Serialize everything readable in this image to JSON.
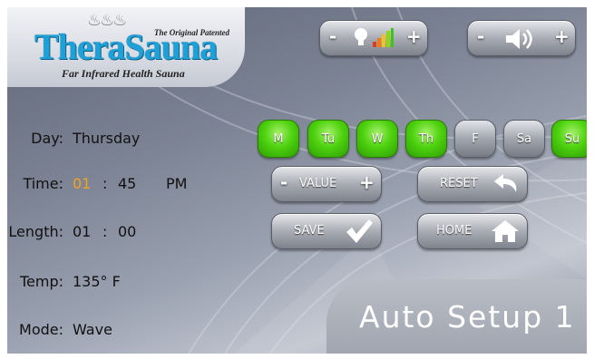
{
  "brand": {
    "name": "TheraSauna",
    "tagline": "The Original Patented",
    "subtitle": "Far Infrared Health Sauna"
  },
  "controls": {
    "light": {
      "minus": "-",
      "plus": "+",
      "icon": "bulb-level-icon"
    },
    "volume": {
      "minus": "-",
      "plus": "+",
      "icon": "speaker-icon"
    }
  },
  "info": {
    "day_label": "Day:",
    "day_value": "Thursday",
    "time_label": "Time:",
    "time_hour": "01",
    "time_sep": ":",
    "time_min": "45",
    "time_ampm": "PM",
    "length_label": "Length:",
    "length_hour": "01",
    "length_sep": ":",
    "length_min": "00",
    "temp_label": "Temp:",
    "temp_value": "135° F",
    "mode_label": "Mode:",
    "mode_value": "Wave"
  },
  "days": [
    {
      "label": "M",
      "active": true
    },
    {
      "label": "Tu",
      "active": true
    },
    {
      "label": "W",
      "active": true
    },
    {
      "label": "Th",
      "active": true
    },
    {
      "label": "F",
      "active": false
    },
    {
      "label": "Sa",
      "active": false
    },
    {
      "label": "Su",
      "active": true
    }
  ],
  "buttons": {
    "value_minus": "-",
    "value_label": "VALUE",
    "value_plus": "+",
    "reset": "RESET",
    "save": "SAVE",
    "home": "HOME"
  },
  "screen_title": "Auto Setup 1",
  "colors": {
    "active_green": "#4fd30f",
    "highlight_orange": "#f5a21d",
    "brand_blue": "#1ea1d8"
  }
}
